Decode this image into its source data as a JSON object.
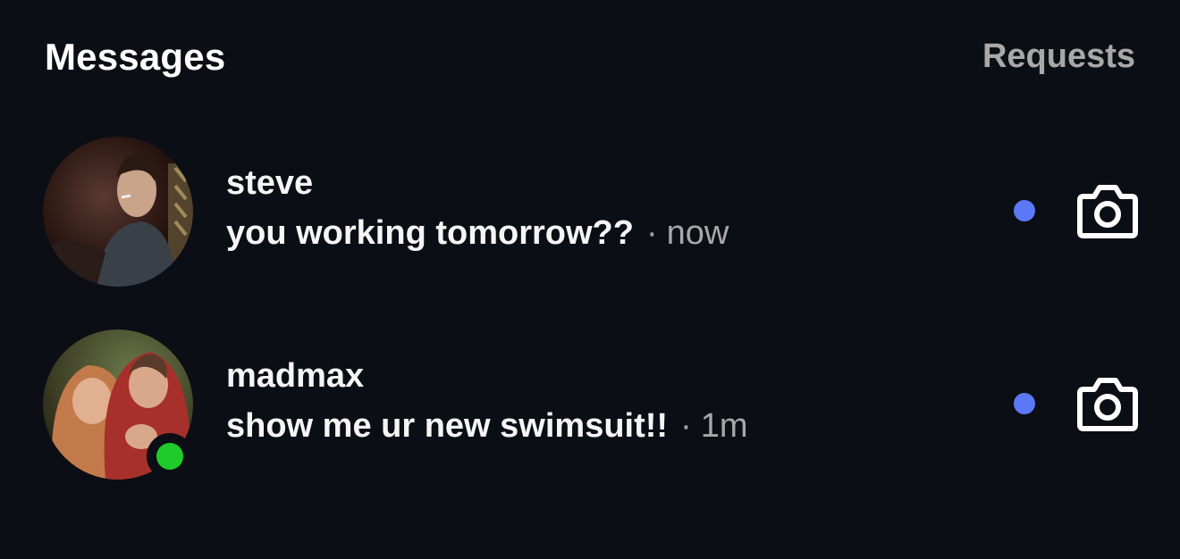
{
  "header": {
    "title": "Messages",
    "requests_label": "Requests"
  },
  "threads": [
    {
      "username": "steve",
      "message": "you working tomorrow??",
      "separator": "·",
      "time": "now",
      "unread": true,
      "online": false
    },
    {
      "username": "madmax",
      "message": "show me ur new swimsuit!!",
      "separator": "·",
      "time": "1m",
      "unread": true,
      "online": true
    }
  ],
  "colors": {
    "background": "#0b0e14",
    "unread_dot": "#5b78f6",
    "online_dot": "#1ecb2a",
    "muted_text": "#a8a8a8"
  },
  "icons": {
    "camera": "camera-icon",
    "unread": "unread-dot-icon",
    "online": "online-status-icon"
  }
}
